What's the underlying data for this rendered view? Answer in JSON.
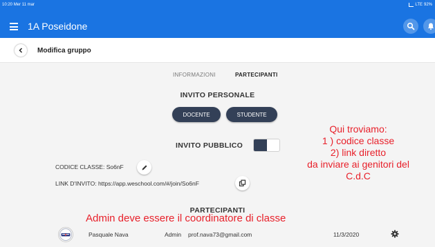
{
  "status_bar": {
    "time": "10:20",
    "date": "Mer 11 mar",
    "network": "LTE",
    "battery": "92%"
  },
  "app_bar": {
    "title": "1A Poseidone"
  },
  "sub_header": {
    "title": "Modifica gruppo"
  },
  "tabs": [
    {
      "label": "INFORMAZIONI",
      "active": false
    },
    {
      "label": "PARTECIPANTI",
      "active": true
    }
  ],
  "invite_personal": {
    "title": "INVITO PERSONALE",
    "teacher_label": "DOCENTE",
    "student_label": "STUDENTE"
  },
  "invite_public": {
    "title": "INVITO PUBBLICO",
    "enabled": true
  },
  "class_code": {
    "label": "CODICE CLASSE:",
    "value": "So6nF"
  },
  "invite_link": {
    "label": "LINK D'INVITO:",
    "value": "https://app.weschool.com/#/join/So6nF"
  },
  "annotation_right": [
    "Qui troviamo:",
    "1 ) codice classe",
    "2) link diretto",
    "da inviare ai genitori del",
    "C.d.C"
  ],
  "participants": {
    "title": "PARTECIPANTI",
    "annotation": "Admin deve essere il coordinatore di classe",
    "rows": [
      {
        "name": "Pasquale Nava",
        "role": "Admin",
        "email": "prof.nava73@gmail.com",
        "date": "11/3/2020"
      }
    ]
  },
  "colors": {
    "primary": "#1a74e2",
    "button_dark": "#334057",
    "annotation": "#e8202a"
  }
}
